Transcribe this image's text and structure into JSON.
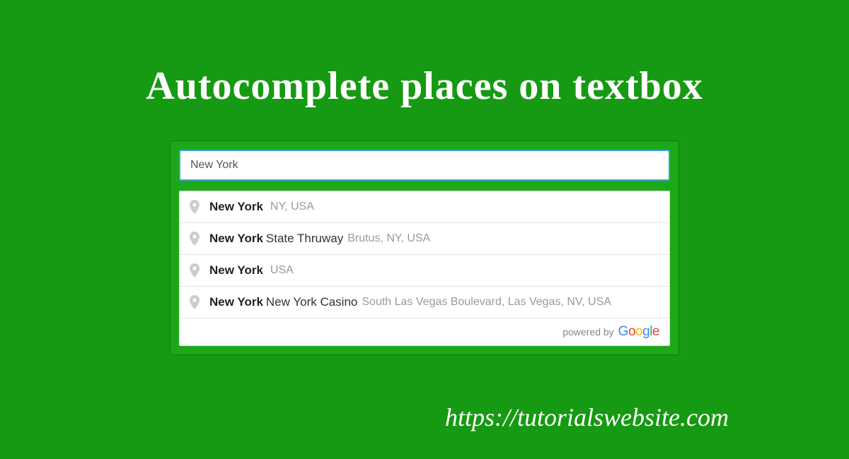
{
  "title": "Autocomplete places on textbox",
  "search": {
    "value": "New York"
  },
  "suggestions": [
    {
      "match": "New York",
      "rest": "",
      "secondary": "NY, USA"
    },
    {
      "match": "New York",
      "rest": "State Thruway",
      "secondary": "Brutus, NY, USA"
    },
    {
      "match": "New York",
      "rest": "",
      "secondary": "USA"
    },
    {
      "match": "New York",
      "rest": "New York Casino",
      "secondary": "South Las Vegas Boulevard, Las Vegas, NV, USA"
    }
  ],
  "powered_by": "powered by",
  "google": {
    "g": "G",
    "o1": "o",
    "o2": "o",
    "g2": "g",
    "l": "l",
    "e": "e"
  },
  "footer_url": "https://tutorialswebsite.com"
}
